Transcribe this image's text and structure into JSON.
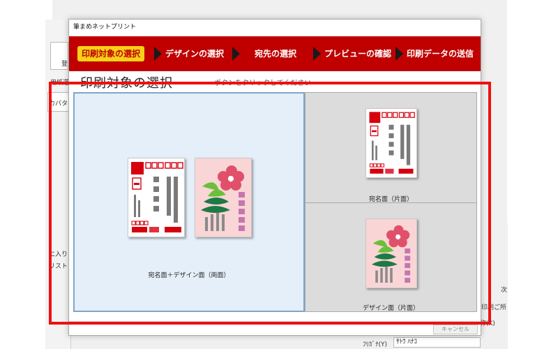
{
  "background_app": {
    "left_labels": [
      "登",
      "用紙選",
      "カパター",
      "に入り",
      "リスト"
    ],
    "right_labels": [
      "次",
      "印刷ご所",
      "称(K)"
    ],
    "furigana_label": "ﾌﾘｶﾞﾅ(Y)",
    "furigana_value": "ｻﾄｳ ﾊﾅｺ"
  },
  "dialog": {
    "title": "筆まめネットプリント",
    "steps": [
      {
        "label": "印刷対象の選択",
        "active": true
      },
      {
        "label": "デザインの選択",
        "active": false
      },
      {
        "label": "宛先の選択",
        "active": false
      },
      {
        "label": "プレビューの確認",
        "active": false
      },
      {
        "label": "印刷データの送信",
        "active": false
      }
    ],
    "heading": "印刷対象の選択",
    "hint": "ボタンをクリックしてください",
    "options": [
      {
        "label": "宛名面＋デザイン面（両面）",
        "selected": true
      },
      {
        "label": "宛名面（片面）",
        "selected": false
      },
      {
        "label": "デザイン面（片面）",
        "selected": false
      }
    ],
    "cancel_label": "キャンセル"
  },
  "colors": {
    "step_bar": "#c00000",
    "active_step": "#f7d117",
    "selected_panel": "#e4eff9",
    "annotation": "#ee1111"
  }
}
